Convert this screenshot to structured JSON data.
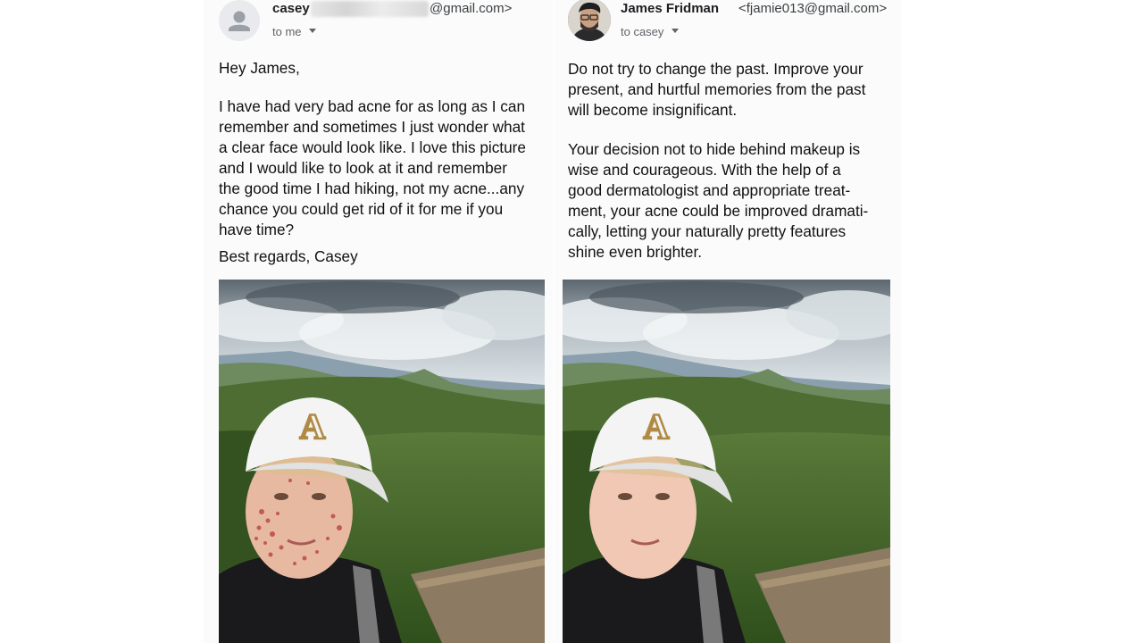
{
  "left_email": {
    "sender_name": "casey",
    "sender_email_suffix": "@gmail.com>",
    "recipient_label": "to me",
    "greeting": "Hey James,",
    "body": "I have had very bad acne for as long as I can\nremember and sometimes I just wonder what\na clear face would look like. I love this picture\nand I would like to look at it and remember\nthe good time I had hiking, not my acne...any\nchance you could get rid of it for me if you\nhave time?",
    "signoff": "Best regards, Casey"
  },
  "right_email": {
    "sender_name": "James Fridman",
    "sender_email": "<fjamie013@gmail.com>",
    "recipient_label": "to casey",
    "paragraph1": "Do not try to change the past. Improve your\npresent, and hurtful memories from the past\nwill become insignificant.",
    "paragraph2": "Your decision not to hide behind makeup is\nwise and courageous. With the help of a\ngood dermatologist and appropriate treat-\nment, your acne could be improved dramati-\ncally, letting your naturally pretty features\nshine even brighter."
  },
  "icons": {
    "default_avatar": "person-icon",
    "expand_caret": "chevron-down-icon"
  },
  "colors": {
    "cap": "#f4f4f4",
    "logo_gold": "#b08a45",
    "foliage": "#4f7a2e",
    "acne": "#b8443f"
  }
}
